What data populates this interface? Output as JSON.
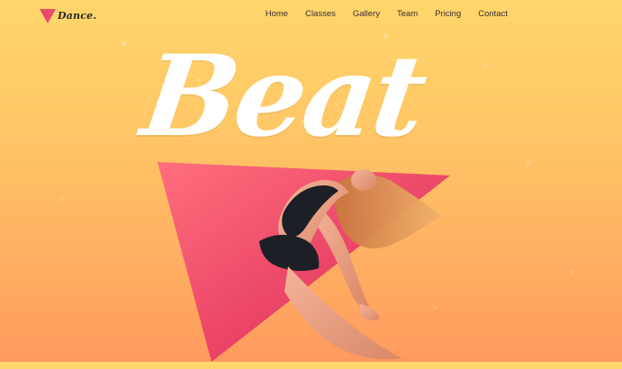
{
  "brand": {
    "logo_text": "Dance."
  },
  "nav": {
    "items": [
      "Home",
      "Classes",
      "Gallery",
      "Team",
      "Pricing",
      "Contact"
    ]
  },
  "hero": {
    "title": "Beat"
  },
  "colors": {
    "background_top": "#ffd66b",
    "background_bottom": "#ff9a5e",
    "accent": "#e84b6a",
    "nav_text": "#3a3030",
    "title_text": "#ffffff"
  }
}
